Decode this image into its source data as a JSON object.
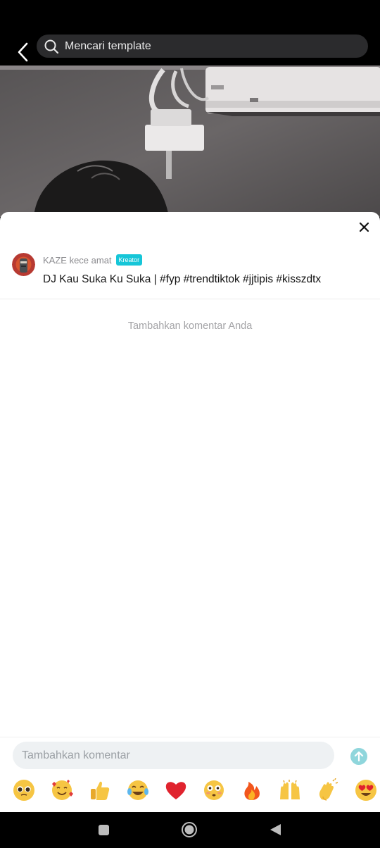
{
  "search": {
    "placeholder": "Mencari template"
  },
  "comment": {
    "author": "KAZE kece amat",
    "badge": "Kreator",
    "text_plain": "DJ Kau Suka Ku Suka | ",
    "text_tags": "#fyp #trendtiktok #jjtipis #kisszdtx"
  },
  "empty_hint": "Tambahkan komentar Anda",
  "input": {
    "placeholder": "Tambahkan komentar"
  },
  "emojis": [
    "pleading-face",
    "smiling-face-with-hearts",
    "thumbs-up",
    "tears-of-joy",
    "red-heart",
    "flushed-face",
    "fire",
    "raising-hands",
    "clapping-hands",
    "heart-eyes"
  ],
  "colors": {
    "badge": "#16c6d8",
    "send": "#8fd6dc",
    "background": "#ffffff"
  }
}
